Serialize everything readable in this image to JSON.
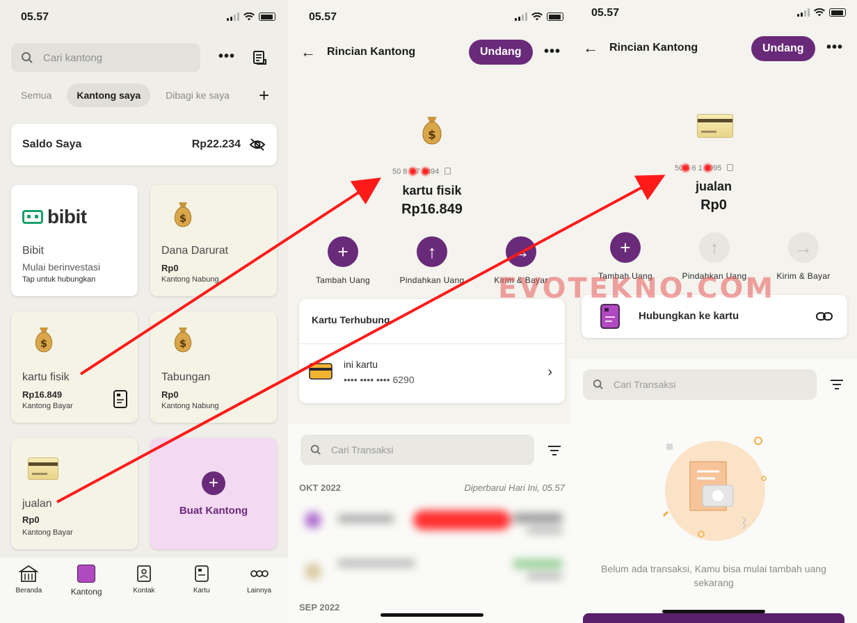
{
  "status": {
    "time": "05.57"
  },
  "panel1": {
    "search_placeholder": "Cari kantong",
    "more_label": "•••",
    "tabs": [
      "Semua",
      "Kantong saya",
      "Dibagi ke saya"
    ],
    "add_label": "+",
    "saldo": {
      "label": "Saldo Saya",
      "amount": "Rp22.234"
    },
    "pockets": {
      "bibit": {
        "name": "Bibit",
        "subtitle": "Mulai berinvestasi",
        "tap": "Tap untuk hubungkan",
        "logo": "bibit"
      },
      "dana_darurat": {
        "name": "Dana Darurat",
        "amount": "Rp0",
        "type": "Kantong Nabung"
      },
      "kartu_fisik": {
        "name": "kartu fisik",
        "amount": "Rp16.849",
        "type": "Kantong Bayar"
      },
      "tabungan": {
        "name": "Tabungan",
        "amount": "Rp0",
        "type": "Kantong Nabung"
      },
      "jualan": {
        "name": "jualan",
        "amount": "Rp0",
        "type": "Kantong Bayar"
      },
      "create": {
        "icon": "+",
        "label": "Buat Kantong"
      }
    },
    "nav": [
      {
        "label": "Beranda",
        "icon": "home-icon"
      },
      {
        "label": "Kantong",
        "icon": "pocket-icon"
      },
      {
        "label": "Kontak",
        "icon": "contact-icon"
      },
      {
        "label": "Kartu",
        "icon": "card-icon"
      },
      {
        "label": "Lainnya",
        "icon": "more-icon"
      }
    ]
  },
  "panel2": {
    "title": "Rincian Kantong",
    "invite": "Undang",
    "more_label": "•••",
    "account": "50 8 7 7 3494",
    "pocket_name": "kartu fisik",
    "pocket_amount": "Rp16.849",
    "actions": [
      "Tambah Uang",
      "Pindahkan Uang",
      "Kirim & Bayar"
    ],
    "linked_card_title": "Kartu Terhubung",
    "card_name": "ini kartu",
    "card_number": "•••• •••• •••• 6290",
    "search_placeholder": "Cari Transaksi",
    "month1": "OKT 2022",
    "updated": "Diperbarui Hari Ini, 05.57",
    "month2": "SEP 2022"
  },
  "panel3": {
    "title": "Rincian Kantong",
    "invite": "Undang",
    "more_label": "•••",
    "account": "50 5 6 1 0095",
    "pocket_name": "jualan",
    "pocket_amount": "Rp0",
    "actions": [
      "Tambah Uang",
      "Pindahkan Uang",
      "Kirim & Bayar"
    ],
    "link_card_label": "Hubungkan ke kartu",
    "search_placeholder": "Cari Transaksi",
    "empty_message": "Belum ada transaksi, Kamu bisa mulai tambah uang sekarang"
  },
  "watermark": "EVOTEKNO.COM",
  "colors": {
    "brand": "#6a2a7a",
    "annotation": "#ff1a1a",
    "bibit_green": "#1aa06b"
  }
}
